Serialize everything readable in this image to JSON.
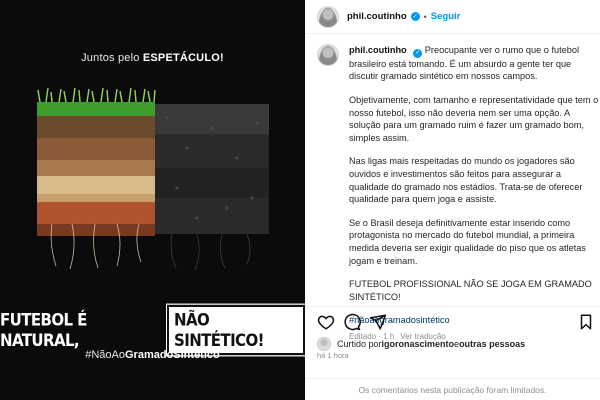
{
  "media": {
    "tagline_prefix": "Juntos pelo ",
    "tagline_bold": "ESPETÁCULO!",
    "headline_left": "FUTEBOL É NATURAL,",
    "headline_right": "NÃO SINTÉTICO!",
    "hashtag_prefix": "#NãoAo",
    "hashtag_bold": "GramadoSintético",
    "colors": {
      "natural_grass": "#5fb83a",
      "synthetic": "#2a2a2a",
      "background": "#0b0b0b"
    }
  },
  "header": {
    "username": "phil.coutinho",
    "verified_icon": "verified-badge-icon",
    "separator": "•",
    "follow_label": "Seguir"
  },
  "caption": {
    "username": "phil.coutinho",
    "paragraphs": [
      "Preocupante ver o rumo que o futebol brasileiro está tomando. É um absurdo a gente ter que discutir gramado sintético em nossos campos.",
      "Objetivamente, com tamanho e representatividade que tem o nosso futebol, isso não deveria nem ser uma opção. A solução para um gramado ruim é fazer um gramado bom, simples assim.",
      "Nas ligas mais respeitadas do mundo os jogadores são ouvidos e investimentos são feitos para assegurar a qualidade do gramado nos estádios. Trata-se de oferecer qualidade para quem joga e assiste.",
      "Se o Brasil deseja definitivamente estar inserido como protagonista no mercado do futebol mundial, a primeira medida deveria ser exigir qualidade do piso que os atletas jogam e treinam.",
      "FUTEBOL PROFISSIONAL NÃO SE JOGA EM GRAMADO SINTÉTICO!"
    ],
    "hashtag": "#nãoaogramadosintético",
    "edited": "Editado · 1 h",
    "translate": "Ver tradução"
  },
  "actions": {
    "like_icon": "heart-icon",
    "comment_icon": "comment-icon",
    "share_icon": "share-icon",
    "save_icon": "bookmark-icon"
  },
  "likes": {
    "prefix": "Curtido por ",
    "user": "igoronascimento",
    "mid": " e ",
    "others": "outras pessoas"
  },
  "timestamp": "há 1 hora",
  "comments_limited": "Os comentários nesta publicação foram limitados."
}
